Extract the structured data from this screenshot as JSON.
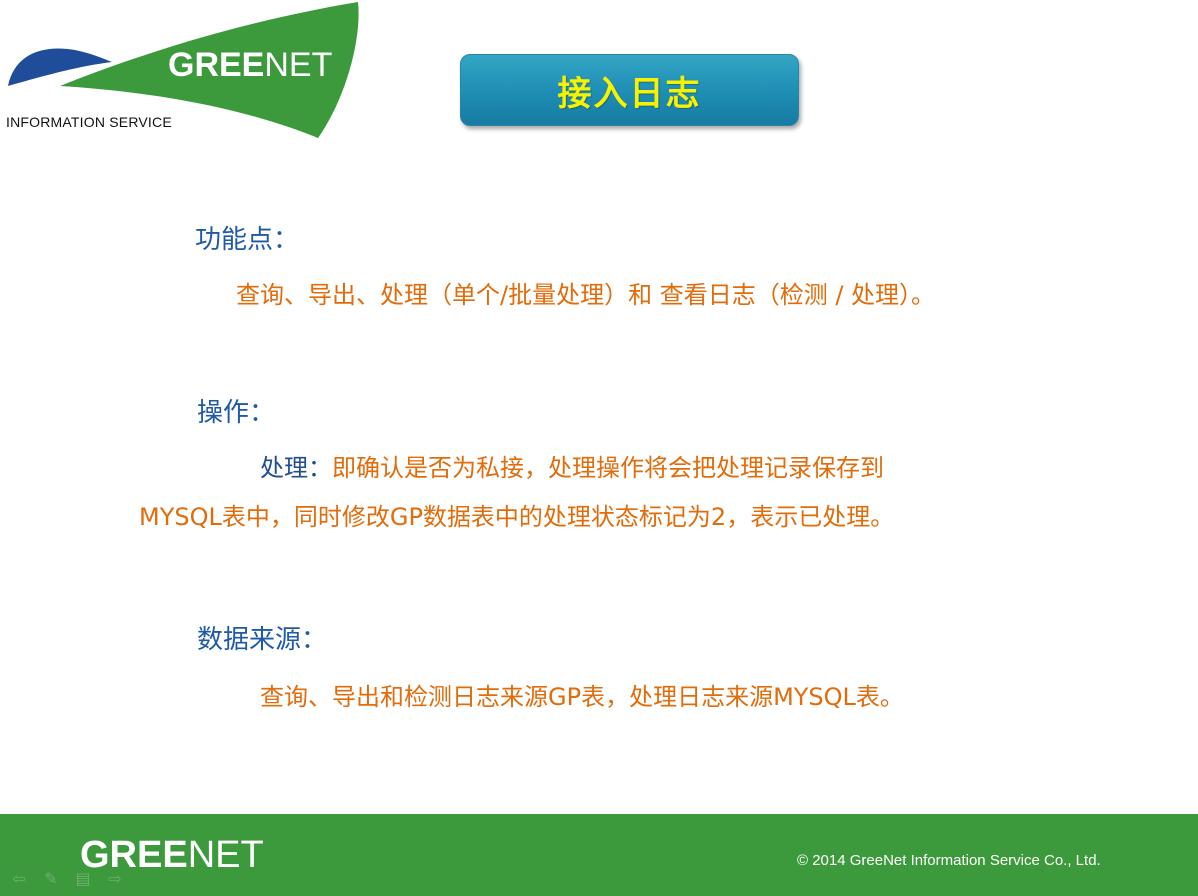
{
  "logo": {
    "word_bold": "GREE",
    "word_thin": "NET",
    "subtitle": "INFORMATION SERVICE"
  },
  "title": "接入日志",
  "sections": {
    "features": {
      "heading": "功能点：",
      "text": "查询、导出、处理（单个/批量处理）和 查看日志（检测 / 处理）。"
    },
    "operations": {
      "heading": "操作：",
      "label": "处理：",
      "line1": "即确认是否为私接，处理操作将会把处理记录保存到",
      "line2": "MYSQL表中，同时修改GP数据表中的处理状态标记为2，表示已处理。"
    },
    "sources": {
      "heading": "数据来源：",
      "text": "查询、导出和检测日志来源GP表，处理日志来源MYSQL表。"
    }
  },
  "footer": {
    "logo_bold": "GREE",
    "logo_thin": "NET",
    "copyright": "© 2014 GreeNet Information Service Co., Ltd."
  },
  "nav_icons": [
    "back-arrow-icon",
    "pen-icon",
    "menu-icon",
    "forward-arrow-icon"
  ],
  "colors": {
    "brand_green": "#3c9a3c",
    "logo_blue": "#1f4d9a",
    "title_text": "#f7f200",
    "heading_blue": "#1f5aa8",
    "body_orange": "#e26b0a"
  }
}
